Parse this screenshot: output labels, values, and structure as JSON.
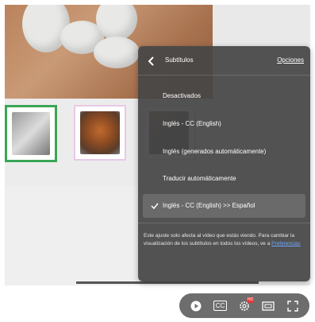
{
  "panel": {
    "title": "Subtítulos",
    "options_link": "Opciones",
    "items": [
      {
        "label": "Desactivados",
        "selected": false
      },
      {
        "label": "Inglés - CC (English)",
        "selected": false
      },
      {
        "label": "Inglés (generados automáticamente)",
        "selected": false
      },
      {
        "label": "Traducir automáticamente",
        "selected": false
      },
      {
        "label": "Inglés - CC (English) >> Español",
        "selected": true
      }
    ],
    "note_text": "Este ajuste solo afecta al vídeo que estás viendo. Para cambiar la visualización de los subtítulos en todos los vídeos, ve a",
    "note_link": "Preferencias"
  },
  "controls": {
    "cc_label": "CC",
    "settings_badge": "HD"
  },
  "colors": {
    "panel_bg": "#464646",
    "link": "#6fa8ff",
    "thumb_selected_border": "#3aa655",
    "thumb_border": "#e8c9e6"
  },
  "icons": [
    "back-chevron-icon",
    "check-icon",
    "play-icon",
    "cc-icon",
    "settings-gear-icon",
    "screen-icon",
    "fullscreen-icon"
  ]
}
